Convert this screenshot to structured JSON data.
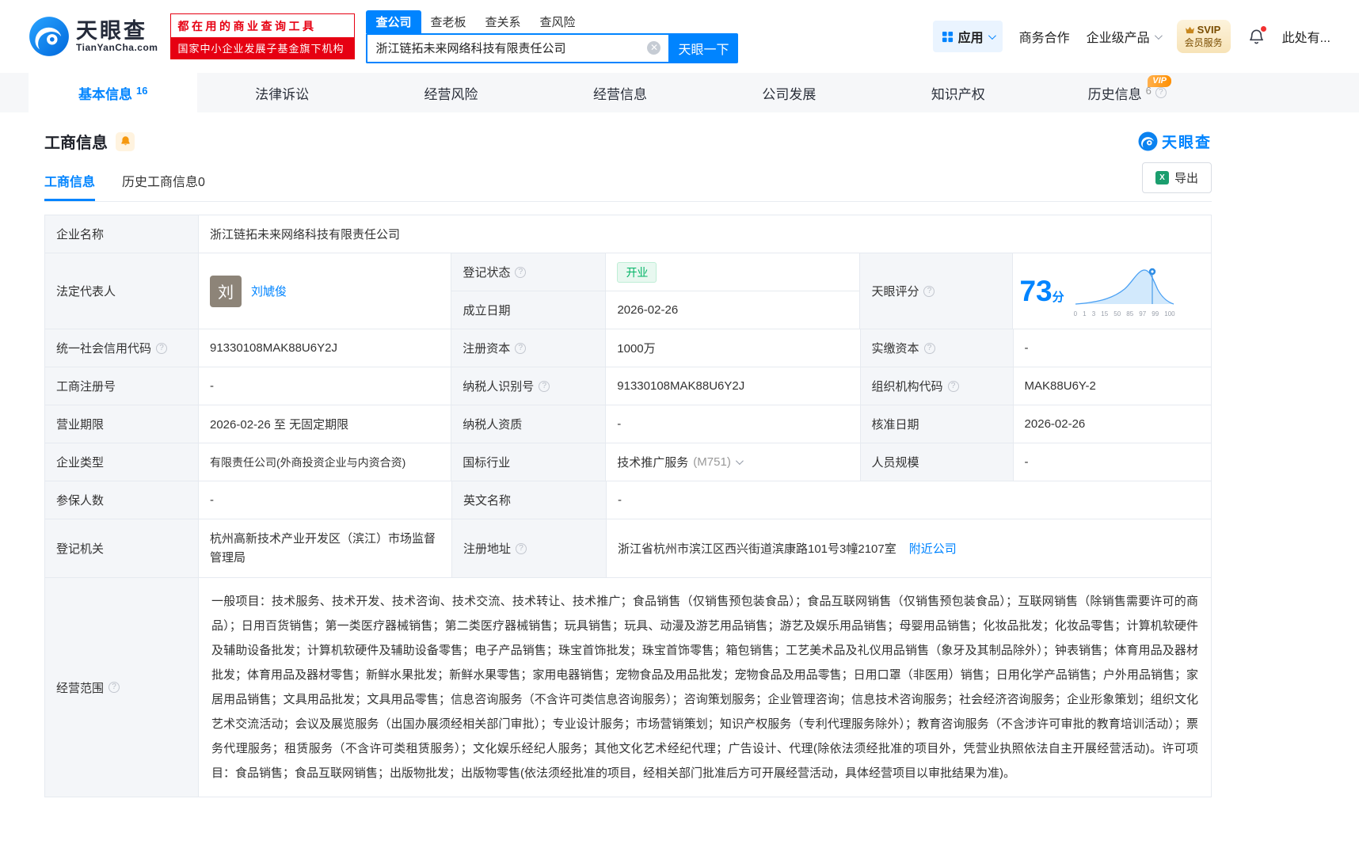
{
  "colors": {
    "accent_blue": "#0084ff",
    "brand_red": "#e60012",
    "status_green": "#00b365",
    "vip_orange": "#ff8f00"
  },
  "header": {
    "logo": {
      "brand": "天眼查",
      "domain": "TianYanCha.com"
    },
    "banner": {
      "line1": "都在用的商业查询工具",
      "line2": "国家中小企业发展子基金旗下机构"
    },
    "search": {
      "tabs": [
        {
          "label": "查公司"
        },
        {
          "label": "查老板"
        },
        {
          "label": "查关系"
        },
        {
          "label": "查风险"
        }
      ],
      "input_value": "浙江链拓未来网络科技有限责任公司",
      "button_label": "天眼一下"
    },
    "menu": {
      "apps": "应用",
      "business_cooperation": "商务合作",
      "enterprise_products": "企业级产品",
      "svip_title": "SVIP",
      "svip_subtitle": "会员服务",
      "user_more": "此处有..."
    }
  },
  "nav": {
    "tabs": [
      {
        "label": "基本信息",
        "count": "16"
      },
      {
        "label": "法律诉讼"
      },
      {
        "label": "经营风险"
      },
      {
        "label": "经营信息"
      },
      {
        "label": "公司发展"
      },
      {
        "label": "知识产权"
      },
      {
        "label": "历史信息",
        "count": "6",
        "badge": "VIP"
      }
    ]
  },
  "section": {
    "title": "工商信息",
    "watermark_brand": "天眼查",
    "subtabs": [
      {
        "label": "工商信息"
      },
      {
        "label": "历史工商信息0"
      }
    ],
    "export_label": "导出"
  },
  "table": {
    "rows": {
      "company_name": {
        "label": "企业名称",
        "value": "浙江链拓未来网络科技有限责任公司"
      },
      "legal_rep": {
        "label": "法定代表人",
        "avatar_char": "刘",
        "name": "刘虓俊"
      },
      "reg_status": {
        "label": "登记状态",
        "value": "开业"
      },
      "establish_date": {
        "label": "成立日期",
        "value": "2026-02-26"
      },
      "score": {
        "label": "天眼评分",
        "value": "73",
        "unit": "分",
        "axis": [
          "0",
          "1",
          "3",
          "15",
          "50",
          "85",
          "97",
          "99",
          "100"
        ]
      },
      "credit_code": {
        "label": "统一社会信用代码",
        "value": "91330108MAK88U6Y2J"
      },
      "reg_capital": {
        "label": "注册资本",
        "value": "1000万"
      },
      "paid_capital": {
        "label": "实缴资本",
        "value": "-"
      },
      "reg_no": {
        "label": "工商注册号",
        "value": "-"
      },
      "taxpayer_no": {
        "label": "纳税人识别号",
        "value": "91330108MAK88U6Y2J"
      },
      "org_code": {
        "label": "组织机构代码",
        "value": "MAK88U6Y-2"
      },
      "term": {
        "label": "营业期限",
        "value": "2026-02-26 至 无固定期限"
      },
      "taxpayer_quality": {
        "label": "纳税人资质",
        "value": "-"
      },
      "approve_date": {
        "label": "核准日期",
        "value": "2026-02-26"
      },
      "company_type": {
        "label": "企业类型",
        "value": "有限责任公司(外商投资企业与内资合资)"
      },
      "industry": {
        "label": "国标行业",
        "value": "技术推广服务",
        "code": "(M751)"
      },
      "staff_size": {
        "label": "人员规模",
        "value": "-"
      },
      "insured": {
        "label": "参保人数",
        "value": "-"
      },
      "en_name": {
        "label": "英文名称",
        "value": "-"
      },
      "authority": {
        "label": "登记机关",
        "value": "杭州高新技术产业开发区（滨江）市场监督管理局"
      },
      "address": {
        "label": "注册地址",
        "value": "浙江省杭州市滨江区西兴街道滨康路101号3幢2107室",
        "nearby_link": "附近公司"
      },
      "scope": {
        "label": "经营范围",
        "value": "一般项目：技术服务、技术开发、技术咨询、技术交流、技术转让、技术推广；食品销售（仅销售预包装食品）；食品互联网销售（仅销售预包装食品）；互联网销售（除销售需要许可的商品）；日用百货销售；第一类医疗器械销售；第二类医疗器械销售；玩具销售；玩具、动漫及游艺用品销售；游艺及娱乐用品销售；母婴用品销售；化妆品批发；化妆品零售；计算机软硬件及辅助设备批发；计算机软硬件及辅助设备零售；电子产品销售；珠宝首饰批发；珠宝首饰零售；箱包销售；工艺美术品及礼仪用品销售（象牙及其制品除外）；钟表销售；体育用品及器材批发；体育用品及器材零售；新鲜水果批发；新鲜水果零售；家用电器销售；宠物食品及用品批发；宠物食品及用品零售；日用口罩（非医用）销售；日用化学产品销售；户外用品销售；家居用品销售；文具用品批发；文具用品零售；信息咨询服务（不含许可类信息咨询服务）；咨询策划服务；企业管理咨询；信息技术咨询服务；社会经济咨询服务；企业形象策划；组织文化艺术交流活动；会议及展览服务（出国办展须经相关部门审批）；专业设计服务；市场营销策划；知识产权服务（专利代理服务除外）；教育咨询服务（不含涉许可审批的教育培训活动）；票务代理服务；租赁服务（不含许可类租赁服务）；文化娱乐经纪人服务；其他文化艺术经纪代理；广告设计、代理(除依法须经批准的项目外，凭营业执照依法自主开展经营活动)。许可项目：食品销售；食品互联网销售；出版物批发；出版物零售(依法须经批准的项目，经相关部门批准后方可开展经营活动，具体经营项目以审批结果为准)。"
      }
    }
  }
}
